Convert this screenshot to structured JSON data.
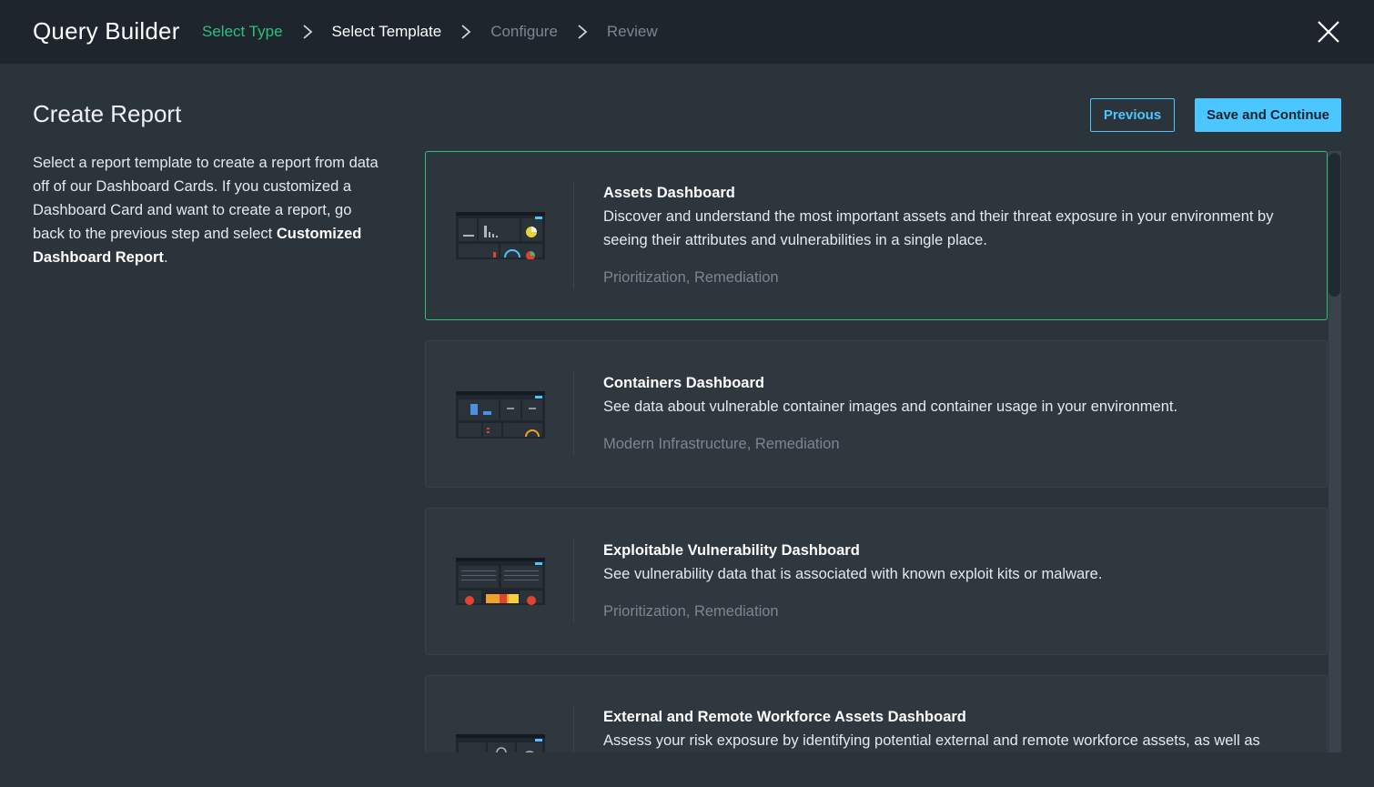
{
  "header": {
    "title": "Query Builder",
    "steps": [
      {
        "label": "Select Type",
        "state": "done"
      },
      {
        "label": "Select Template",
        "state": "active"
      },
      {
        "label": "Configure",
        "state": "todo"
      },
      {
        "label": "Review",
        "state": "todo"
      }
    ],
    "close_icon": "close-icon"
  },
  "page": {
    "title": "Create Report",
    "intro_text": "Select a report template to create a report from data off of our Dashboard Cards. If you customized a Dashboard Card and want to create a report, go back to the previous step and select ",
    "intro_bold": "Customized Dashboard Report",
    "intro_end": "."
  },
  "actions": {
    "previous_label": "Previous",
    "save_label": "Save and Continue"
  },
  "templates": [
    {
      "title": "Assets Dashboard",
      "description": "Discover and understand the most important assets and their threat exposure in your environment by seeing their attributes and vulnerabilities in a single place.",
      "tags": "Prioritization, Remediation",
      "selected": true
    },
    {
      "title": "Containers Dashboard",
      "description": "See data about vulnerable container images and container usage in your environment.",
      "tags": "Modern Infrastructure, Remediation",
      "selected": false
    },
    {
      "title": "Exploitable Vulnerability Dashboard",
      "description": "See vulnerability data that is associated with known exploit kits or malware.",
      "tags": "Prioritization, Remediation",
      "selected": false
    },
    {
      "title": "External and Remote Workforce Assets Dashboard",
      "description": "Assess your risk exposure by identifying potential external and remote workforce assets, as well as",
      "tags": "",
      "selected": false
    }
  ],
  "colors": {
    "accent_green": "#2fbf7f",
    "accent_blue": "#4cc6ff",
    "header_bg": "#1e252c",
    "body_bg": "#2b333b"
  }
}
